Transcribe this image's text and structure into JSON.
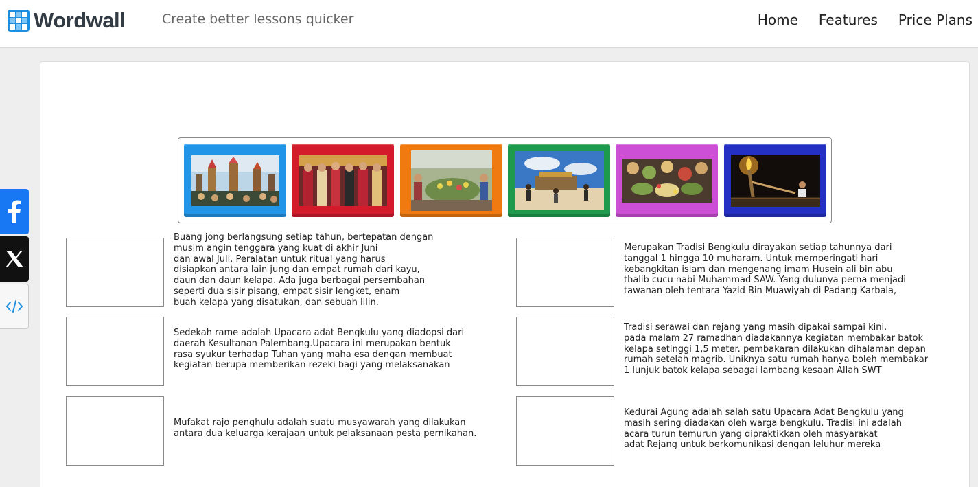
{
  "header": {
    "logo_text": "Wordwall",
    "tagline": "Create better lessons quicker",
    "nav": [
      "Home",
      "Features",
      "Price Plans"
    ]
  },
  "share": {
    "facebook_icon": "facebook-icon",
    "x_icon": "x-icon",
    "embed_icon": "embed-code-icon"
  },
  "tiles": [
    {
      "color": "#2196e8",
      "icon": "photo-festival-towers"
    },
    {
      "color": "#d41b2c",
      "icon": "photo-traditional-dress-group"
    },
    {
      "color": "#f07a10",
      "icon": "photo-offerings-crowd"
    },
    {
      "color": "#1e9a4c",
      "icon": "photo-beach-ritual"
    },
    {
      "color": "#cc4fd6",
      "icon": "photo-food-offerings"
    },
    {
      "color": "#2430c4",
      "icon": "photo-night-torch"
    }
  ],
  "descriptions": [
    "Buang jong berlangsung setiap tahun, bertepatan dengan\nmusim angin tenggara yang kuat di akhir Juni\ndan awal Juli. Peralatan untuk ritual yang harus\ndisiapkan antara lain jung dan empat rumah dari kayu,\ndaun dan daun kelapa. Ada juga berbagai persembahan\nseperti dua sisir pisang, empat sisir lengket, enam\nbuah kelapa yang disatukan, dan sebuah lilin.",
    "Merupakan Tradisi Bengkulu dirayakan setiap tahunnya dari\ntanggal 1 hingga 10 muharam. Untuk memperingati hari\nkebangkitan islam dan mengenang imam Husein ali bin abu\nthalib cucu nabi Muhammad SAW. Yang dulunya perna menjadi\ntawanan oleh tentara Yazid Bin Muawiyah di Padang Karbala,",
    "Sedekah rame adalah Upacara adat Bengkulu yang diadopsi dari\ndaerah Kesultanan Palembang.Upacara ini merupakan bentuk\nrasa syukur terhadap Tuhan yang maha esa dengan membuat\nkegiatan berupa memberikan rezeki bagi yang melaksanakan",
    "Tradisi serawai dan rejang yang masih dipakai sampai kini.\npada malam 27 ramadhan diadakannya kegiatan membakar batok\nkelapa setinggi 1,5 meter. pembakaran dilakukan dihalaman depan\nrumah setelah magrib. Uniknya satu rumah hanya boleh membakar\n1 lunjuk batok kelapa sebagai lambang kesaan Allah SWT",
    "Mufakat rajo penghulu adalah suatu musyawarah yang dilakukan\nantara dua keluarga kerajaan untuk pelaksanaan pesta pernikahan.",
    "Kedurai Agung adalah salah satu Upacara Adat Bengkulu yang\nmasih sering diadakan oleh warga bengkulu. Tradisi ini adalah\nacara turun temurun yang dipraktikkan oleh masyarakat\nadat Rejang untuk berkomunikasi dengan leluhur mereka"
  ]
}
